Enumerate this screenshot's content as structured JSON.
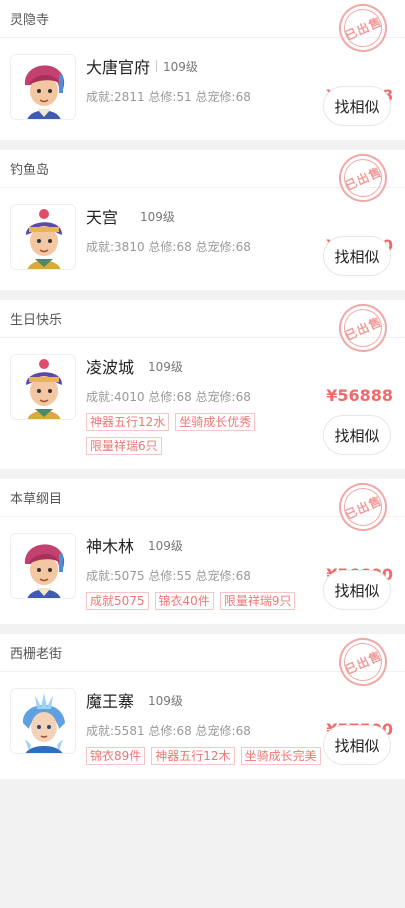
{
  "listings": [
    {
      "server": "灵隐寺",
      "stamp": "已出售",
      "name": "大唐官府",
      "level": "109级",
      "stats": "成就:2811 总修:51 总宠修:68",
      "price": "¥58888",
      "tags": [],
      "button": "找相似",
      "avatar": "avatar-red-hair-icon"
    },
    {
      "server": "钓鱼岛",
      "stamp": "已出售",
      "name": "天宫",
      "level": "109级",
      "stats": "成就:3810 总修:68 总宠修:68",
      "price": "¥60000",
      "tags": [],
      "button": "找相似",
      "avatar": "avatar-purple-hair-icon"
    },
    {
      "server": "生日快乐",
      "stamp": "已出售",
      "name": "凌波城",
      "level": "109级",
      "stats": "成就:4010 总修:68 总宠修:68",
      "price": "¥56888",
      "tags": [
        "神器五行12水",
        "坐骑成长优秀",
        "限量祥瑞6只"
      ],
      "button": "找相似",
      "avatar": "avatar-purple-hair-icon"
    },
    {
      "server": "本草纲目",
      "stamp": "已出售",
      "name": "神木林",
      "level": "109级",
      "stats": "成就:5075 总修:55 总宠修:68",
      "price": "¥56600",
      "tags": [
        "成就5075",
        "锦衣40件",
        "限量祥瑞9只"
      ],
      "button": "找相似",
      "avatar": "avatar-red-hair-icon"
    },
    {
      "server": "西栅老街",
      "stamp": "已出售",
      "name": "魔王寨",
      "level": "109级",
      "stats": "成就:5581 总修:68 总宠修:68",
      "price": "¥57500",
      "tags": [
        "锦衣89件",
        "神器五行12木",
        "坐骑成长完美"
      ],
      "button": "找相似",
      "avatar": "avatar-blue-hair-icon"
    }
  ],
  "colors": {
    "accent": "#f06a6a",
    "tag_border": "#f4c6c6",
    "background": "#f2f2f2"
  }
}
